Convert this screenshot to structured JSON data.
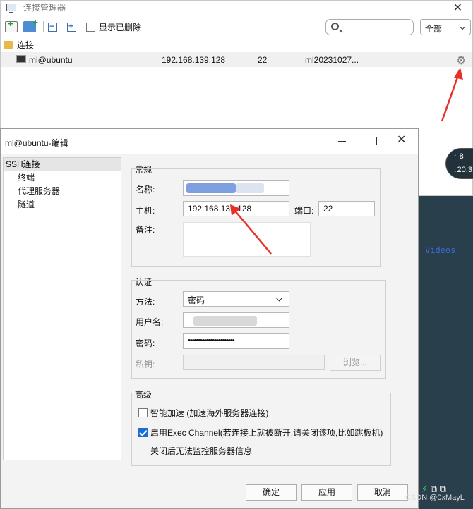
{
  "connection_manager": {
    "title": "连接管理器",
    "close_glyph": "✕",
    "show_deleted_label": "显示已删除",
    "search_placeholder": "",
    "filter_value": "全部",
    "group_name": "连接",
    "row": {
      "name": "ml@ubuntu",
      "host": "192.168.139.128",
      "port": "22",
      "note": "ml20231027..."
    }
  },
  "dialog": {
    "title": "ml@ubuntu-编辑",
    "nav": [
      {
        "label": "SSH连接"
      },
      {
        "label": "终端"
      },
      {
        "label": "代理服务器"
      },
      {
        "label": "隧道"
      }
    ],
    "general": {
      "section": "常规",
      "name_label": "名称:",
      "host_label": "主机:",
      "host_value": "192.168.139.128",
      "port_label": "端口:",
      "port_value": "22",
      "note_label": "备注:"
    },
    "auth": {
      "section": "认证",
      "method_label": "方法:",
      "method_value": "密码",
      "username_label": "用户名:",
      "password_label": "密码:",
      "password_value": "•••••••••••••••••••••••",
      "key_label": "私钥:",
      "browse_label": "浏览..."
    },
    "advanced": {
      "section": "高级",
      "accel_label": "智能加速 (加速海外服务器连接)",
      "accel_checked": false,
      "exec_label": "启用Exec Channel(若连接上就被断开,请关闭该项,比如跳板机)",
      "exec_checked": true,
      "exec_note": "关闭后无法监控服务器信息"
    },
    "buttons": {
      "ok": "确定",
      "apply": "应用",
      "cancel": "取消"
    }
  },
  "desktop": {
    "videos_label": "Videos",
    "net_up": "8",
    "net_down": "20.3",
    "watermark": "CSDN @0xMayL"
  },
  "colors": {
    "annotation_arrow": "#e8302a",
    "checkbox_accent": "#1c6fd1"
  }
}
